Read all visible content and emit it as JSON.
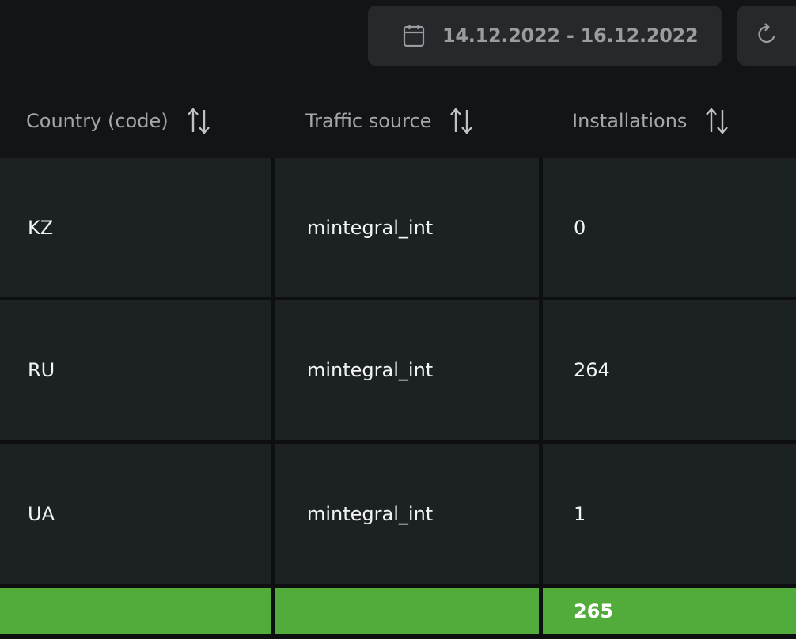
{
  "toolbar": {
    "date_range": "14.12.2022 - 16.12.2022",
    "calendar_icon": "calendar-icon",
    "refresh_icon": "refresh-icon"
  },
  "table": {
    "columns": [
      {
        "label": "Country (code)",
        "sort_icon": "sort-arrows-icon"
      },
      {
        "label": "Traffic source",
        "sort_icon": "sort-arrows-icon"
      },
      {
        "label": "Installations",
        "sort_icon": "sort-arrows-icon"
      }
    ],
    "rows": [
      {
        "country": "KZ",
        "source": "mintegral_int",
        "installations": "0"
      },
      {
        "country": "RU",
        "source": "mintegral_int",
        "installations": "264"
      },
      {
        "country": "UA",
        "source": "mintegral_int",
        "installations": "1"
      }
    ],
    "totals": {
      "country": "",
      "source": "",
      "installations": "265"
    }
  },
  "colors": {
    "background": "#121417",
    "cell": "#1c2223",
    "control": "#25292c",
    "total_row": "#51ac3b",
    "header_text": "#a4a7a9"
  }
}
